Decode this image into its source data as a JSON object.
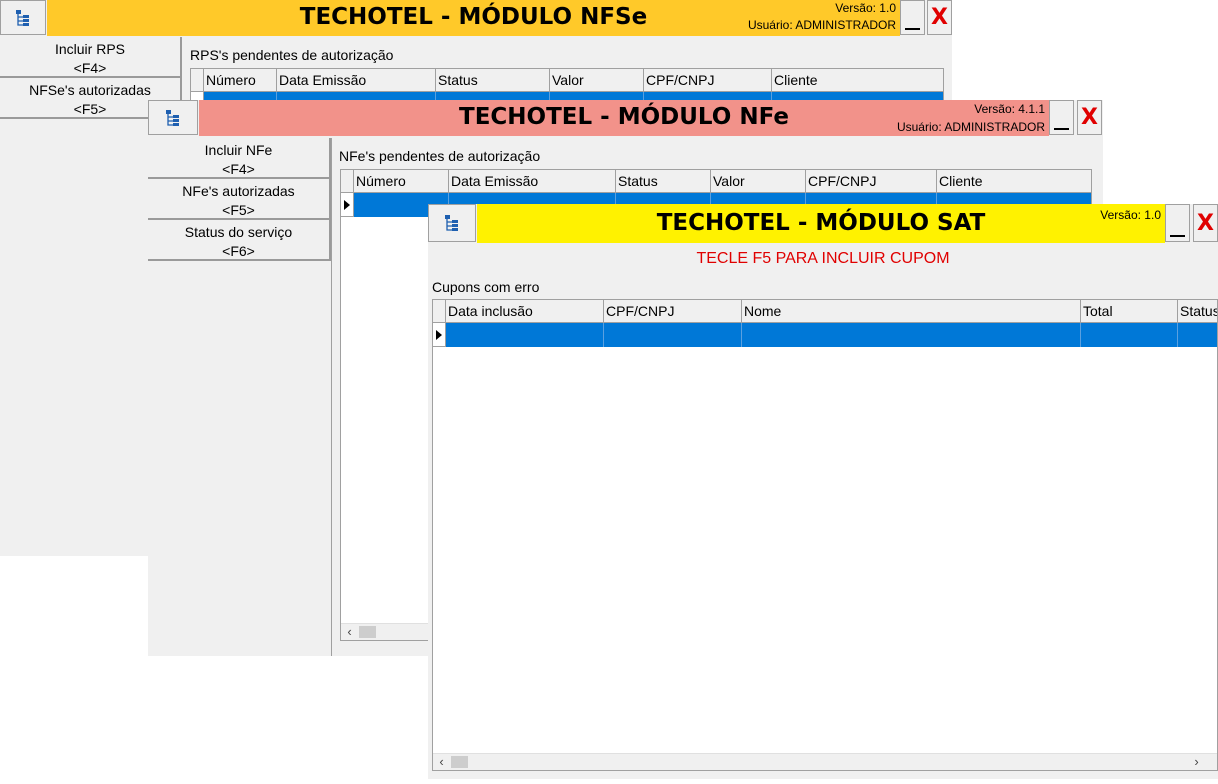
{
  "nfse": {
    "title": "TECHOTEL - MÓDULO NFSe",
    "version": "Versão: 1.0",
    "user": "Usuário: ADMINISTRADOR",
    "title_color": "#ffc929",
    "close_label": "X",
    "icon": "tree-icon",
    "nav": [
      {
        "label": "Incluir RPS",
        "key": "<F4>"
      },
      {
        "label": "NFSe's autorizadas",
        "key": "<F5>"
      }
    ],
    "section": "RPS's pendentes de autorização",
    "columns": [
      "Número",
      "Data Emissão",
      "Status",
      "Valor",
      "CPF/CNPJ",
      "Cliente"
    ]
  },
  "nfe": {
    "title": "TECHOTEL - MÓDULO NFe",
    "version": "Versão: 4.1.1",
    "user": "Usuário: ADMINISTRADOR",
    "title_color": "#f2928a",
    "close_label": "X",
    "icon": "tree-icon",
    "nav": [
      {
        "label": "Incluir NFe",
        "key": "<F4>"
      },
      {
        "label": "NFe's autorizadas",
        "key": "<F5>"
      },
      {
        "label": "Status do serviço",
        "key": "<F6>"
      }
    ],
    "section": "NFe's pendentes de autorização",
    "columns": [
      "Número",
      "Data Emissão",
      "Status",
      "Valor",
      "CPF/CNPJ",
      "Cliente"
    ]
  },
  "sat": {
    "title": "TECHOTEL - MÓDULO SAT",
    "version": "Versão: 1.0",
    "title_color": "#fff200",
    "close_label": "X",
    "icon": "tree-icon",
    "notice": "TECLE F5 PARA INCLUIR CUPOM",
    "notice_color": "#e00000",
    "section": "Cupons com erro",
    "columns": [
      "Data inclusão",
      "CPF/CNPJ",
      "Nome",
      "Total",
      "Status"
    ]
  },
  "colors": {
    "selection": "#0078d7",
    "window_bg": "#f0f0f0"
  }
}
